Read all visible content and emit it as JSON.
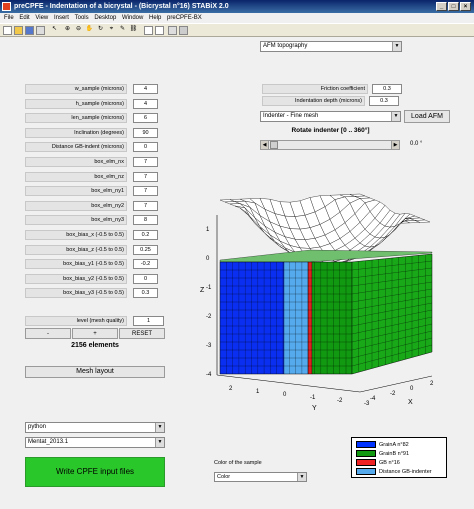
{
  "window": {
    "title": "preCPFE - Indentation of a bicrystal - (Bicrystal n°16) STABiX 2.0"
  },
  "menu": [
    "File",
    "Edit",
    "View",
    "Insert",
    "Tools",
    "Desktop",
    "Window",
    "Help",
    "preCPFE-BX"
  ],
  "afm_dropdown": {
    "selected": "AFM topography"
  },
  "parameters": [
    {
      "label": "w_sample (microns)",
      "value": "4"
    },
    {
      "label": "h_sample (microns)",
      "value": "4"
    },
    {
      "label": "len_sample (microns)",
      "value": "6"
    },
    {
      "label": "Inclination (degrees)",
      "value": "90"
    },
    {
      "label": "Distance GB-indent (microns)",
      "value": "0"
    },
    {
      "label": "box_elm_nx",
      "value": "7"
    },
    {
      "label": "box_elm_nz",
      "value": "7"
    },
    {
      "label": "box_elm_ny1",
      "value": "7"
    },
    {
      "label": "box_elm_ny2",
      "value": "7"
    },
    {
      "label": "box_elm_ny3",
      "value": "8"
    },
    {
      "label": "box_bias_x (-0.5 to 0.5)",
      "value": "0.2"
    },
    {
      "label": "box_bias_z (-0.5 to 0.5)",
      "value": "0.25"
    },
    {
      "label": "box_bias_y1 (-0.5 to 0.5)",
      "value": "-0.2"
    },
    {
      "label": "box_bias_y2 (-0.5 to 0.5)",
      "value": "0"
    },
    {
      "label": "box_bias_y3 (-0.5 to 0.5)",
      "value": "0.3"
    }
  ],
  "mesh_quality": {
    "label": "level (mesh quality)",
    "value": "1",
    "minus": "-",
    "plus": "+",
    "reset": "RESET"
  },
  "elements_count": "2156 elements",
  "mesh_layout_button": "Mesh layout",
  "python_dropdown": "python",
  "mentat_dropdown": "Mentat_2013.1",
  "write_button": "Write CPFE  input files",
  "friction": {
    "label": "Friction coefficient",
    "value": "0.3"
  },
  "indentation_depth": {
    "label": "Indentation depth (microns)",
    "value": "0.3"
  },
  "indenter_dropdown": "Indenter - Fine mesh",
  "load_afm_button": "Load AFM",
  "rotate_label": "Rotate indenter [0 .. 360°]",
  "rotate_value": "0.0  °",
  "rotate_slider_fraction": 0.0,
  "color_sample": {
    "label": "Color of the sample",
    "selected": "Color"
  },
  "legend": [
    {
      "label": "GrainA n°82",
      "color": "#0033ff"
    },
    {
      "label": "GrainB n°91",
      "color": "#119911"
    },
    {
      "label": "GB n°16",
      "color": "#ee2222"
    },
    {
      "label": "Distance GB-indenter",
      "color": "#55aaee"
    }
  ],
  "axes": {
    "z_label": "Z",
    "y_label": "Y",
    "x_label": "X",
    "z_ticks": [
      "1",
      "0",
      "-1",
      "-2",
      "-3",
      "-4"
    ],
    "y_ticks": [
      "2",
      "1",
      "0",
      "-1",
      "-2",
      "-3"
    ],
    "x_ticks": [
      "-4",
      "-2",
      "0",
      "2"
    ]
  }
}
